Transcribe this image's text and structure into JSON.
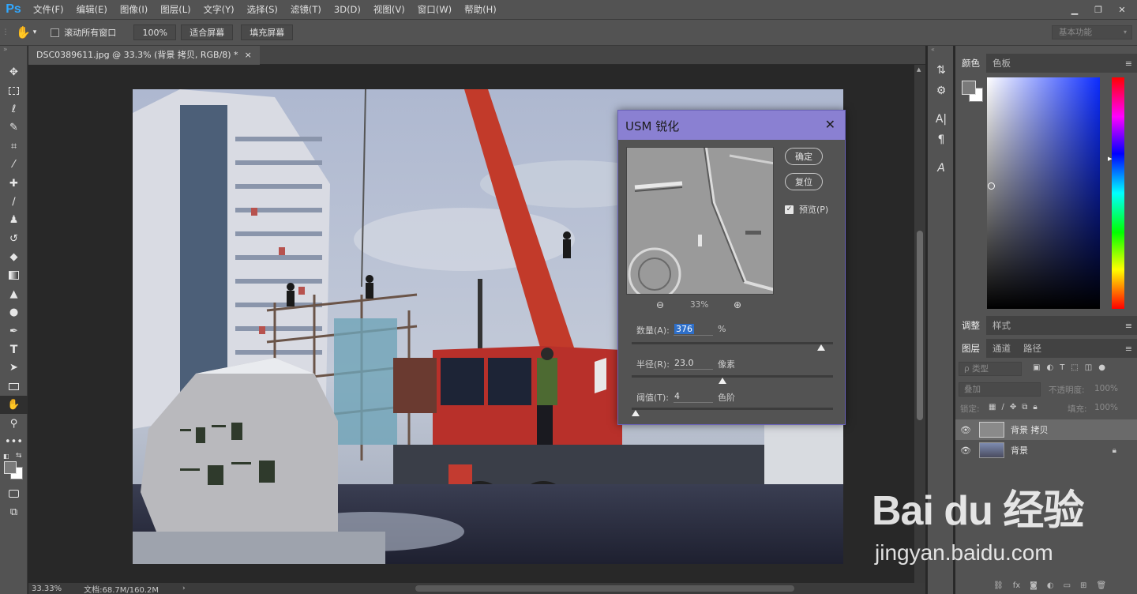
{
  "app": {
    "logo": "Ps"
  },
  "menu": [
    "文件(F)",
    "编辑(E)",
    "图像(I)",
    "图层(L)",
    "文字(Y)",
    "选择(S)",
    "滤镜(T)",
    "3D(D)",
    "视图(V)",
    "窗口(W)",
    "帮助(H)"
  ],
  "options": {
    "scroll_all_label": "滚动所有窗口",
    "zoom_value": "100%",
    "fit_screen": "适合屏幕",
    "fill_screen": "填充屏幕",
    "workspace": "基本功能"
  },
  "document": {
    "tab_title": "DSC0389611.jpg @ 33.3% (背景 拷贝, RGB/8) *",
    "tab_close": "×"
  },
  "status": {
    "zoom": "33.33%",
    "doc_size": "文档:68.7M/160.2M"
  },
  "usm": {
    "title": "USM 锐化",
    "ok": "确定",
    "reset": "复位",
    "preview_label": "预览(P)",
    "preview_checked": true,
    "zoom": "33%",
    "amount_label": "数量(A):",
    "amount_value": "376",
    "amount_unit": "%",
    "amount_pos": 0.94,
    "radius_label": "半径(R):",
    "radius_value": "23.0",
    "radius_unit": "像素",
    "radius_pos": 0.45,
    "threshold_label": "阈值(T):",
    "threshold_value": "4",
    "threshold_unit": "色阶",
    "threshold_pos": 0.02
  },
  "panels": {
    "color_tabs": [
      "颜色",
      "色板"
    ],
    "adjust_tabs": [
      "调整",
      "样式"
    ],
    "layers_tabs": [
      "图层",
      "通道",
      "路径"
    ],
    "kind_filter": "ρ 类型",
    "blend_mode": "叠加",
    "opacity_label": "不透明度:",
    "opacity_value": "100%",
    "lock_label": "锁定:",
    "fill_label": "填充:",
    "fill_value": "100%",
    "layers": [
      {
        "name": "背景 拷贝",
        "selected": true,
        "locked": false
      },
      {
        "name": "背景",
        "selected": false,
        "locked": true
      }
    ]
  },
  "watermark": {
    "brand": "Bai du 经验",
    "url": "jingyan.baidu.com"
  },
  "colors": {
    "accent": "#31a8ff",
    "dialog_title": "#8a80d2",
    "selected_text": "#1f6fd1"
  }
}
